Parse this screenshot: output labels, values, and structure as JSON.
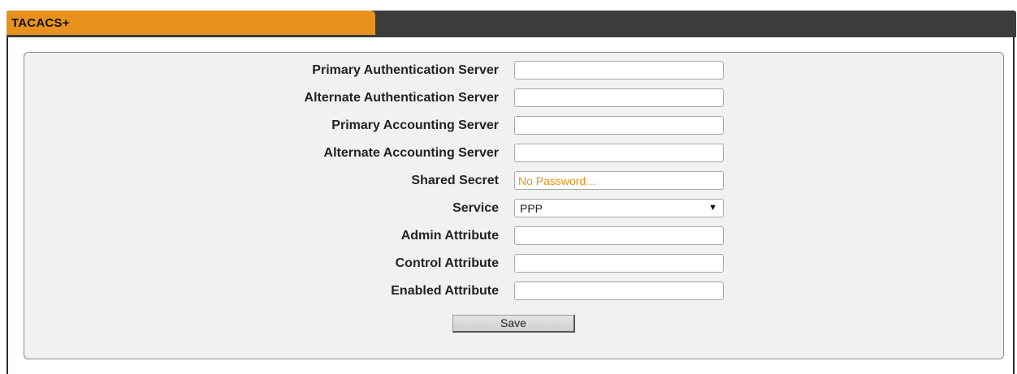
{
  "tab": {
    "title": "TACACS+"
  },
  "form": {
    "fields": [
      {
        "label": "Primary Authentication Server",
        "value": "",
        "placeholder": ""
      },
      {
        "label": "Alternate Authentication Server",
        "value": "",
        "placeholder": ""
      },
      {
        "label": "Primary Accounting Server",
        "value": "",
        "placeholder": ""
      },
      {
        "label": "Alternate Accounting Server",
        "value": "",
        "placeholder": ""
      },
      {
        "label": "Shared Secret",
        "value": "",
        "placeholder": "No Password..."
      },
      {
        "label": "Service",
        "value": "PPP"
      },
      {
        "label": "Admin Attribute",
        "value": "",
        "placeholder": ""
      },
      {
        "label": "Control Attribute",
        "value": "",
        "placeholder": ""
      },
      {
        "label": "Enabled Attribute",
        "value": "",
        "placeholder": ""
      }
    ],
    "save_label": "Save"
  },
  "icons": {
    "dropdown": "chevron-down-icon"
  },
  "colors": {
    "tab_accent": "#e8921e",
    "tab_strip": "#3c3c3c",
    "placeholder": "#e8921e",
    "form_background": "#f1f1f1"
  }
}
